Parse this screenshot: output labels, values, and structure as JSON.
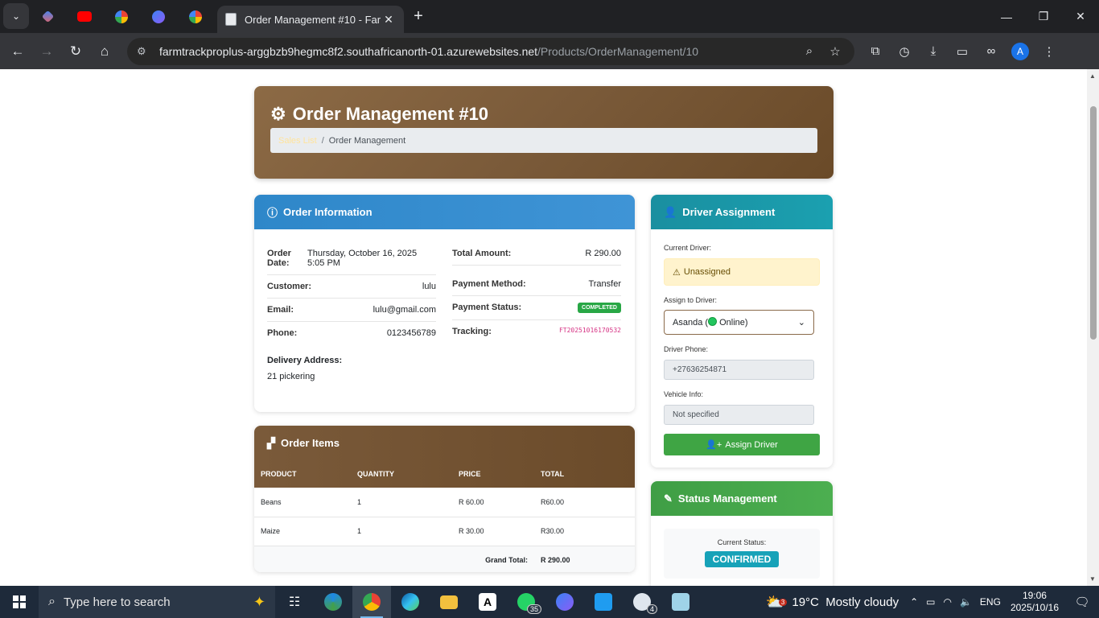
{
  "browser": {
    "active_tab_title": "Order Management #10 - Farm",
    "url_host": "farmtrackproplus-arggbzb9hegmc8f2.southafricanorth-01.azurewebsites.net",
    "url_path": "/Products/OrderManagement/10",
    "profile_initial": "A"
  },
  "page": {
    "title": "Order Management #10",
    "breadcrumb": {
      "link": "Sales List",
      "separator": "/",
      "current": "Order Management"
    }
  },
  "order_info": {
    "heading": "Order Information",
    "left": [
      {
        "label": "Order Date:",
        "value": "Thursday, October 16, 2025 5:05 PM"
      },
      {
        "label": "Customer:",
        "value": "lulu"
      },
      {
        "label": "Email:",
        "value": "lulu@gmail.com"
      },
      {
        "label": "Phone:",
        "value": "0123456789"
      }
    ],
    "right": [
      {
        "label": "Total Amount:",
        "value": "R 290.00"
      },
      {
        "label": "Payment Method:",
        "value": "Transfer"
      },
      {
        "label": "Payment Status:",
        "value": "COMPLETED"
      },
      {
        "label": "Tracking:",
        "value": "FT20251016170532"
      }
    ],
    "delivery_label": "Delivery Address:",
    "delivery_value": "21 pickering"
  },
  "order_items": {
    "heading": "Order Items",
    "columns": [
      "PRODUCT",
      "QUANTITY",
      "PRICE",
      "TOTAL"
    ],
    "rows": [
      {
        "product": "Beans",
        "quantity": "1",
        "price": "R 60.00",
        "total": "R60.00"
      },
      {
        "product": "Maize",
        "quantity": "1",
        "price": "R 30.00",
        "total": "R30.00"
      }
    ],
    "grand_total_label": "Grand Total:",
    "grand_total_value": "R 290.00"
  },
  "driver": {
    "heading": "Driver Assignment",
    "current_label": "Current Driver:",
    "current_value": "Unassigned",
    "assign_label": "Assign to Driver:",
    "select_name": "Asanda (",
    "select_status": " Online)",
    "phone_label": "Driver Phone:",
    "phone_value": "+27636254871",
    "vehicle_label": "Vehicle Info:",
    "vehicle_value": "Not specified",
    "assign_button": "Assign Driver"
  },
  "status": {
    "heading": "Status Management",
    "current_label": "Current Status:",
    "current_value": "CONFIRMED"
  },
  "taskbar": {
    "search_placeholder": "Type here to search",
    "whatsapp_badge": "35",
    "mail_badge": "4",
    "weather_badge": "3",
    "weather": "19°C  Mostly cloudy",
    "lang": "ENG",
    "time": "19:06",
    "date": "2025/10/16"
  },
  "colors": {
    "header_brown": "#7a5a39",
    "info_blue": "#2e87c9",
    "driver_teal": "#1a8fa0",
    "status_green": "#4caf50",
    "completed_badge": "#28a745",
    "confirmed_badge": "#17a2b8"
  }
}
